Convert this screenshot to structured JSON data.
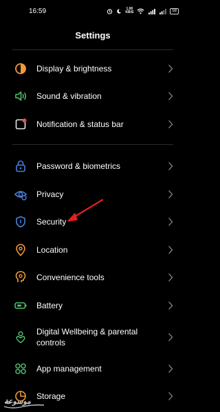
{
  "status": {
    "time": "16:59",
    "net_speed_value": "1.00",
    "net_speed_unit": "KB/S",
    "battery": "58"
  },
  "page": {
    "title": "Settings"
  },
  "groups": [
    {
      "items": [
        {
          "label": "Display & brightness",
          "icon": "display-brightness-icon",
          "color": "#f29a3b"
        },
        {
          "label": "Sound & vibration",
          "icon": "sound-icon",
          "color": "#4fbf69"
        },
        {
          "label": "Notification & status bar",
          "icon": "notification-icon",
          "color": "#e05050"
        }
      ]
    },
    {
      "items": [
        {
          "label": "Password & biometrics",
          "icon": "lock-icon",
          "color": "#4a7fd8"
        },
        {
          "label": "Privacy",
          "icon": "privacy-eye-icon",
          "color": "#4a7fd8"
        },
        {
          "label": "Security",
          "icon": "shield-icon",
          "color": "#4a7fd8"
        },
        {
          "label": "Location",
          "icon": "location-pin-icon",
          "color": "#f29a3b"
        },
        {
          "label": "Convenience tools",
          "icon": "convenience-tools-icon",
          "color": "#f29a3b"
        },
        {
          "label": "Battery",
          "icon": "battery-icon",
          "color": "#4fbf69"
        },
        {
          "label": "Digital Wellbeing & parental controls",
          "label_line1": "Digital Wellbeing & parental",
          "label_line2": "controls",
          "icon": "wellbeing-icon",
          "color": "#4fbf69"
        },
        {
          "label": "App management",
          "icon": "app-management-icon",
          "color": "#4fbf69"
        },
        {
          "label": "Storage",
          "icon": "storage-icon",
          "color": "#f29a3b"
        }
      ]
    }
  ],
  "annotation": {
    "arrow_color": "#e02020"
  },
  "watermark": {
    "text": "موسوعة"
  }
}
